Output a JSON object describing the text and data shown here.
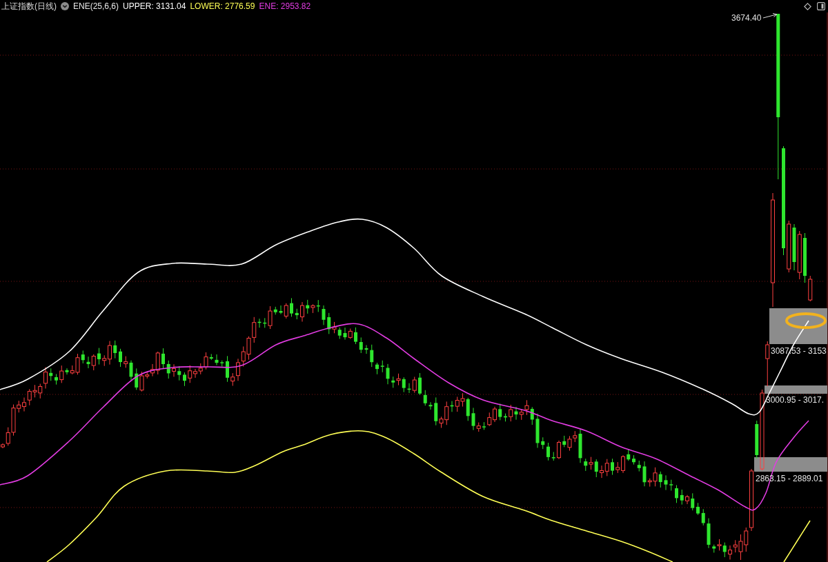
{
  "header": {
    "title": "上证指数(日线)",
    "indicator": "ENE(25,6,6)",
    "readings": [
      {
        "label": "UPPER: 3131.04",
        "color": "#ffffff"
      },
      {
        "label": "LOWER: 2776.59",
        "color": "#ffff55"
      },
      {
        "label": "ENE: 2953.82",
        "color": "#e23ce2"
      }
    ]
  },
  "chart": {
    "high_label": "3674.40",
    "zones": [
      {
        "label": "3087.53 - 3153"
      },
      {
        "label": "3000.95 - 3017."
      },
      {
        "label": "2863.15 - 2889.01"
      }
    ]
  }
}
